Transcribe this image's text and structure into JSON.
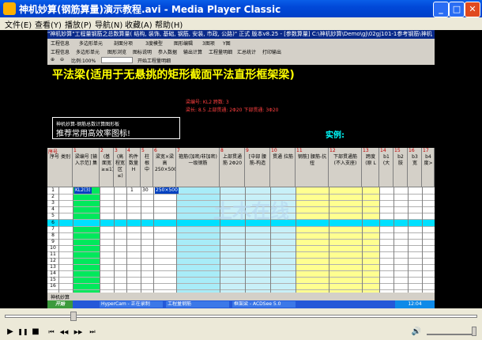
{
  "window": {
    "title": "神机妙算(钢筋算量)演示教程.avi - Media Player Classic",
    "minimize_glyph": "_",
    "maximize_glyph": "□",
    "close_glyph": "✕"
  },
  "menu": {
    "items": [
      "文件(E)",
      "查看(Y)",
      "播放(P)",
      "导航(N)",
      "收藏(A)",
      "帮助(H)"
    ]
  },
  "video": {
    "inner_title": "\"神机妙算\"工程量钢筋之总数算量( 结构, 装饰, 基础, 钢筋, 安装, 市政, 公路)\" 正式 版本v8.25 - [参数算量] C:\\神机妙算\\Demo\\gj\\02gj101-1参考钢筋\\神机",
    "toolbar1": [
      "工程信息",
      "多边形单元",
      "剖面分项",
      "3度模型",
      "图形编辑",
      "3图项",
      "Y图"
    ],
    "toolbar2": [
      "工程信息",
      "多边形单元",
      "图形浏览",
      "图标说明",
      "参入数据",
      "输出计算",
      "工程量明细",
      "汇总统计",
      "打印输出"
    ],
    "toolbar3": {
      "zoom_label": "比例:100%",
      "button": "开始工程量明细"
    },
    "banner_title": "平法梁(适用于无悬挑的矩形截面平法直形框架梁)",
    "banner_notes": [
      "梁编号: KL2  跨数: 3",
      "梁长: 8.5  上部贯通: 2Φ20  下部贯通: 3Φ20"
    ],
    "hint_line1": "神机妙算-钢筋总数计算图形板",
    "hint_line2": "推荐常用高效率图标!",
    "example_label": "实例:",
    "columns": [
      {
        "num": "序号",
        "text": "序号 类别"
      },
      {
        "num": "1",
        "text": "梁编号 [输入示范] 集"
      },
      {
        "num": "2",
        "text": "(基 面宽 ≥≤1)"
      },
      {
        "num": "3",
        "text": "(高 程宽 区≤)"
      },
      {
        "num": "4",
        "text": "构件 数量 H"
      },
      {
        "num": "5",
        "text": "柱 根 中"
      },
      {
        "num": "6",
        "text": "梁宽×梁高 250×500"
      },
      {
        "num": "7",
        "text": "箍筋(加密/非加密) 一级钢筋"
      },
      {
        "num": "8",
        "text": "上部贯通筋 2Φ20"
      },
      {
        "num": "9",
        "text": "[中部 腰筋-构造"
      },
      {
        "num": "10",
        "text": "贯通 拉筋"
      },
      {
        "num": "11",
        "text": "钢筋] 腰筋-抗扭"
      },
      {
        "num": "12",
        "text": "下部贯通筋 (不入支座)"
      },
      {
        "num": "13",
        "text": "跨度 (原 L"
      },
      {
        "num": "14",
        "text": "b1 (大"
      },
      {
        "num": "15",
        "text": "b2 肢"
      },
      {
        "num": "16",
        "text": "b3 宽"
      },
      {
        "num": "17",
        "text": "b4 度>"
      }
    ],
    "row_numbers": [
      "1",
      "2",
      "3",
      "4",
      "5",
      "6",
      "7",
      "8",
      "9",
      "10",
      "11",
      "12",
      "13",
      "14",
      "15",
      "16"
    ],
    "row1_values": {
      "name": "KL2(3)",
      "count": "1",
      "spans": "30",
      "section": "250×500"
    },
    "watermark": "土木在线",
    "sheet_tab": "神机妙算",
    "taskbar": {
      "start": "开始",
      "items": [
        "HyperCam - 正在录制",
        "工程量钢筋",
        "框架梁 - ACDSee 5.0"
      ],
      "clock": "12:04"
    }
  },
  "player": {
    "play_icon": "▶",
    "pause_icon": "❚❚",
    "stop_icon": "■",
    "prev_icon": "⏮",
    "rew_icon": "◀◀",
    "fwd_icon": "▶▶",
    "next_icon": "⏭",
    "volume_icon": "🔊",
    "seek_position": 0.14,
    "volume_level": 0.98
  }
}
